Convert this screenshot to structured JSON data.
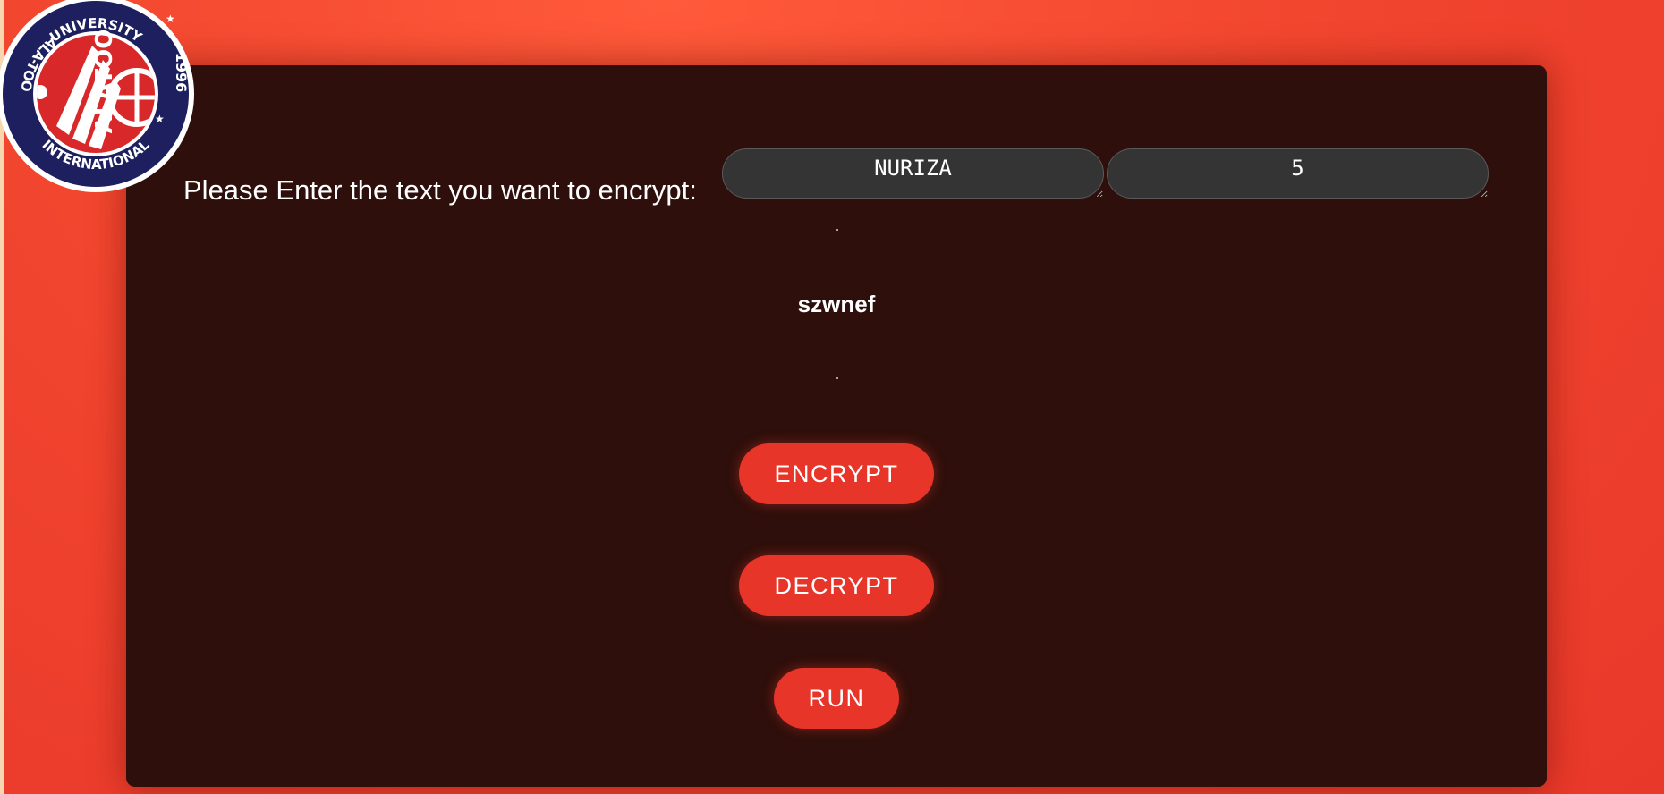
{
  "logo": {
    "name": "ALATOO",
    "text_top": "UNIVERSITY",
    "text_left": "ALA-TOO",
    "text_bottom": "INTERNATIONAL",
    "year": "1996"
  },
  "form": {
    "prompt": "Please Enter the text you want to encrypt:",
    "text_value": "NURIZA",
    "key_value": "5"
  },
  "result": {
    "text": "szwnef"
  },
  "buttons": {
    "encrypt": "ENCRYPT",
    "decrypt": "DECRYPT",
    "run": "RUN"
  },
  "colors": {
    "background": "#f2462f",
    "panel": "#2e0f0b",
    "button": "#e8352a",
    "field": "#343434",
    "logo_navy": "#1d1f5e",
    "logo_red": "#d8282a"
  }
}
